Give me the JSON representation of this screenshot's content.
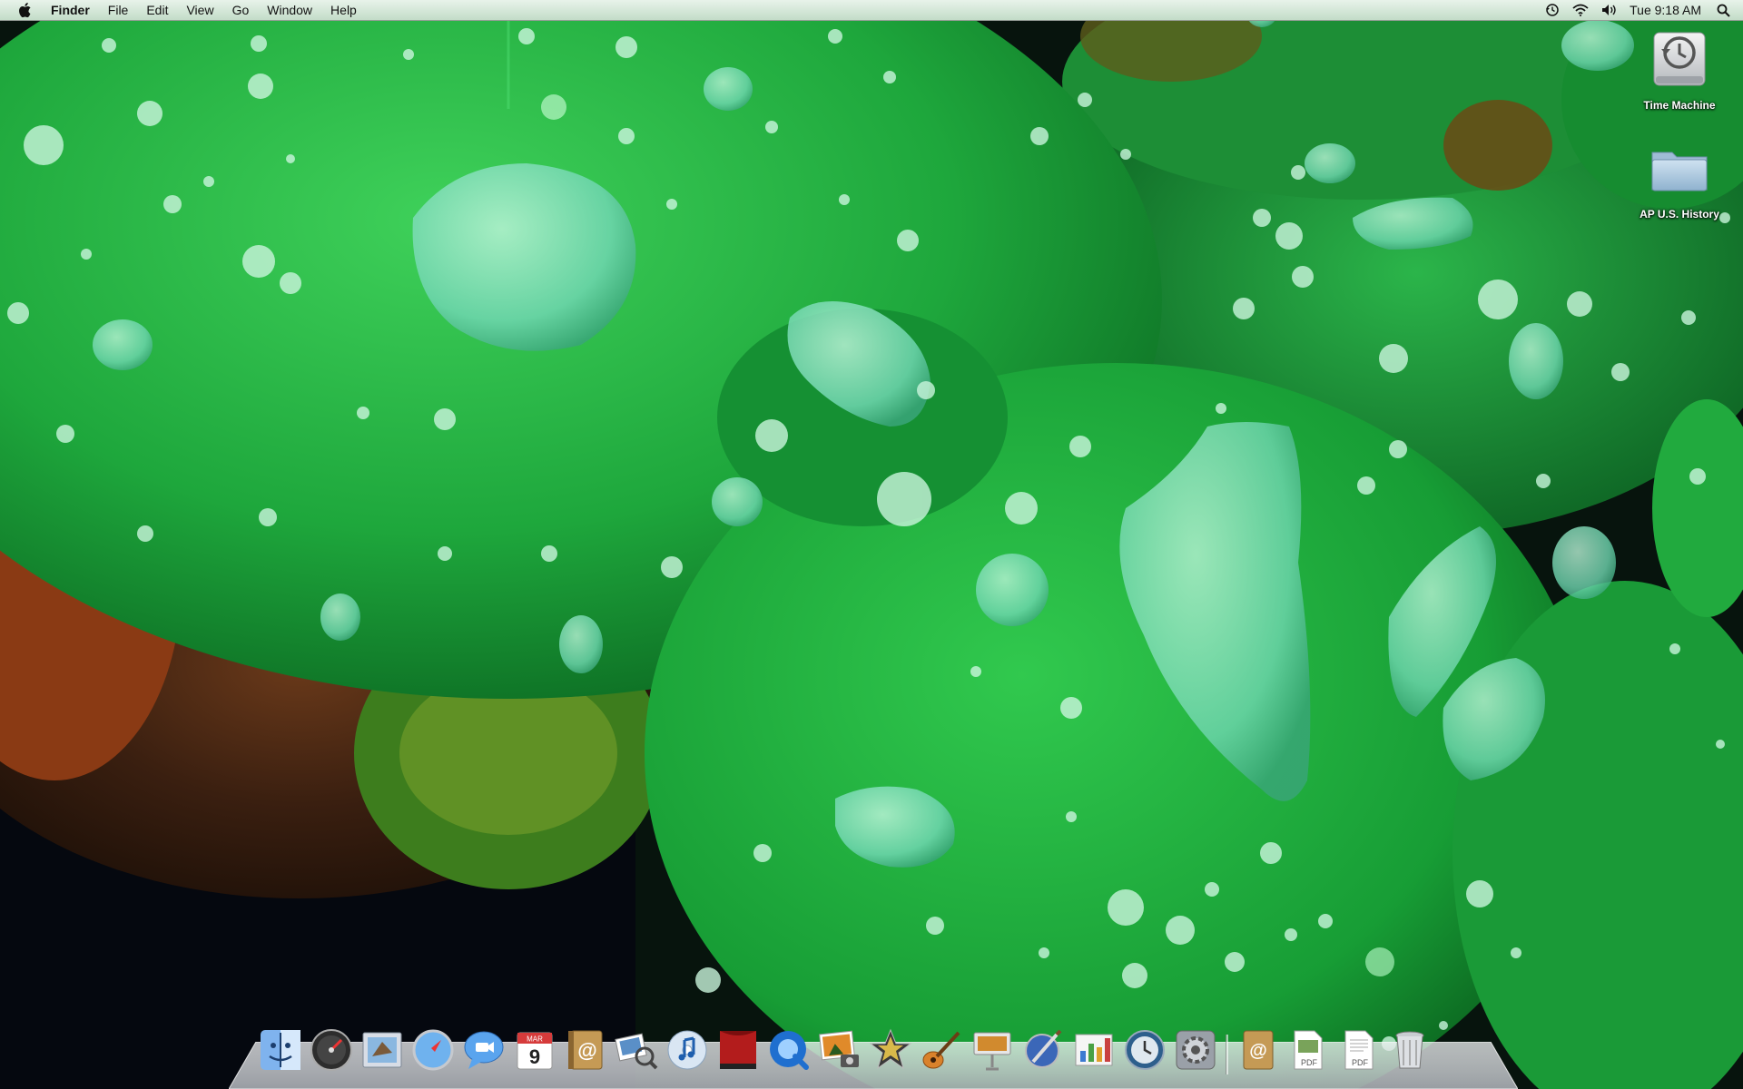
{
  "menubar": {
    "apple_icon": "apple-logo-icon",
    "app_name": "Finder",
    "menus": [
      "File",
      "Edit",
      "View",
      "Go",
      "Window",
      "Help"
    ],
    "status_icons": [
      "time-machine-icon",
      "wifi-icon",
      "volume-icon"
    ],
    "clock": "Tue 9:18 AM",
    "spotlight_icon": "spotlight-search-icon"
  },
  "desktop": {
    "icons": [
      {
        "label": "Time Machine",
        "icon": "time-machine-drive-icon"
      },
      {
        "label": "AP U.S. History",
        "icon": "folder-icon"
      }
    ],
    "wallpaper": "green lotus leaves with water droplets"
  },
  "dock": {
    "apps": [
      {
        "name": "finder-icon"
      },
      {
        "name": "dashboard-icon"
      },
      {
        "name": "mail-icon"
      },
      {
        "name": "safari-icon"
      },
      {
        "name": "ichat-icon"
      },
      {
        "name": "ical-icon",
        "text": "9",
        "month": "MAR"
      },
      {
        "name": "address-book-icon"
      },
      {
        "name": "preview-icon"
      },
      {
        "name": "itunes-icon"
      },
      {
        "name": "front-row-icon"
      },
      {
        "name": "quicktime-icon"
      },
      {
        "name": "iphoto-icon"
      },
      {
        "name": "imovie-icon"
      },
      {
        "name": "garageband-icon"
      },
      {
        "name": "keynote-icon"
      },
      {
        "name": "iweb-icon"
      },
      {
        "name": "numbers-icon"
      },
      {
        "name": "time-machine-icon"
      },
      {
        "name": "system-preferences-icon"
      }
    ],
    "stacks": [
      {
        "name": "address-stack-icon"
      },
      {
        "name": "pdf-document-icon",
        "text": "PDF"
      },
      {
        "name": "pdf-document-icon-2",
        "text": "PDF"
      },
      {
        "name": "trash-icon"
      }
    ],
    "colors": {
      "accent": "#2f7de1"
    }
  }
}
